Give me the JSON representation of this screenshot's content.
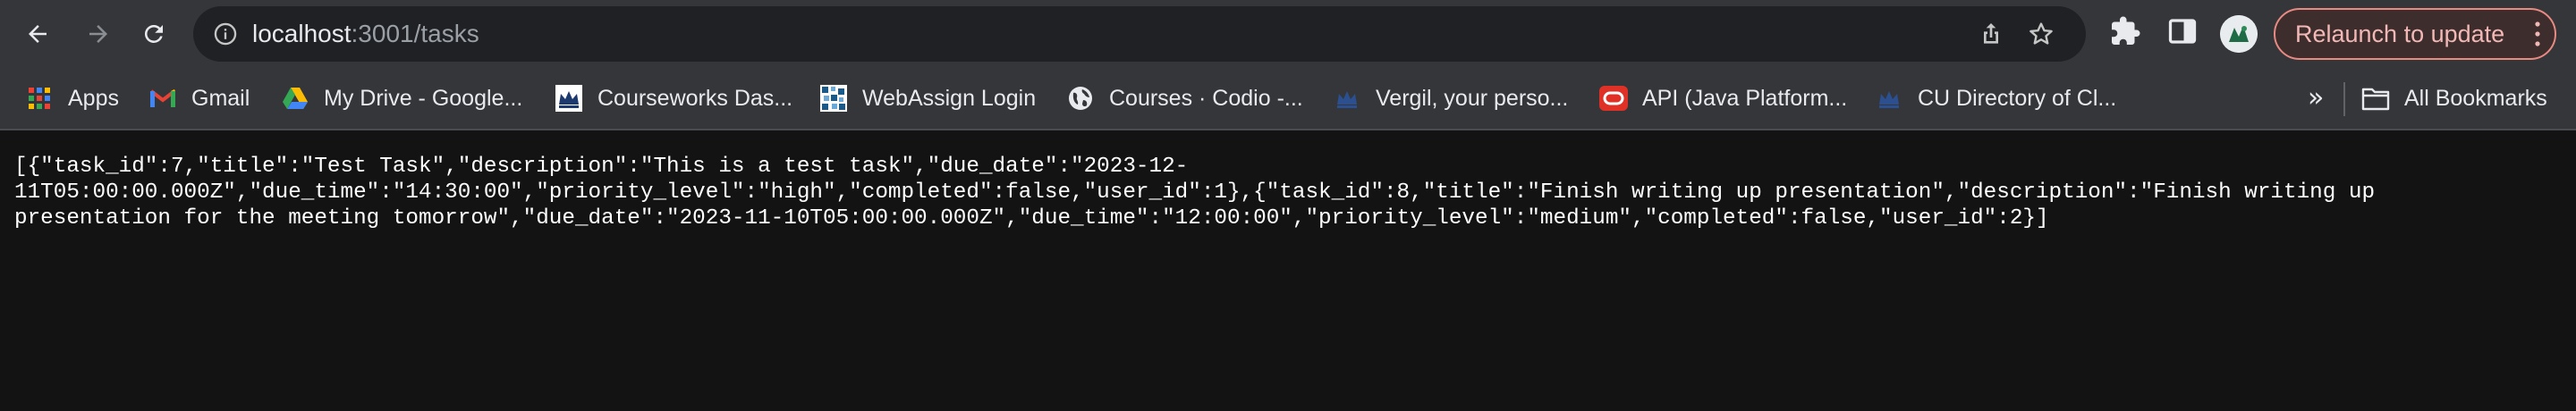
{
  "toolbar": {
    "back_icon": "arrow-left-icon",
    "forward_icon": "arrow-right-icon",
    "reload_icon": "reload-icon",
    "url_host": "localhost",
    "url_path": ":3001/tasks",
    "relaunch_label": "Relaunch to update",
    "colors": {
      "toolbar_bg": "#35363a",
      "omnibox_bg": "#202124",
      "relaunch_border": "#e88a82",
      "relaunch_text": "#f2b8b5"
    }
  },
  "bookmarks": {
    "items": [
      {
        "label": "Apps",
        "icon": "apps-grid-icon"
      },
      {
        "label": "Gmail",
        "icon": "gmail-icon"
      },
      {
        "label": "My Drive - Google...",
        "icon": "google-drive-icon"
      },
      {
        "label": "Courseworks Das...",
        "icon": "columbia-crown-icon"
      },
      {
        "label": "WebAssign Login",
        "icon": "webassign-icon"
      },
      {
        "label": "Courses · Codio -...",
        "icon": "globe-icon"
      },
      {
        "label": "Vergil, your perso...",
        "icon": "columbia-crown-icon"
      },
      {
        "label": "API (Java Platform...",
        "icon": "oracle-icon"
      },
      {
        "label": "CU Directory of Cl...",
        "icon": "columbia-crown-icon"
      }
    ],
    "overflow_label": "»",
    "all_bookmarks_label": "All Bookmarks"
  },
  "page": {
    "lines": [
      "[{\"task_id\":7,\"title\":\"Test Task\",\"description\":\"This is a test task\",\"due_date\":\"2023-12-",
      "11T05:00:00.000Z\",\"due_time\":\"14:30:00\",\"priority_level\":\"high\",\"completed\":false,\"user_id\":1},{\"task_id\":8,\"title\":\"Finish writing up presentation\",\"description\":\"Finish writing up",
      "presentation for the meeting tomorrow\",\"due_date\":\"2023-11-10T05:00:00.000Z\",\"due_time\":\"12:00:00\",\"priority_level\":\"medium\",\"completed\":false,\"user_id\":2}]"
    ]
  }
}
